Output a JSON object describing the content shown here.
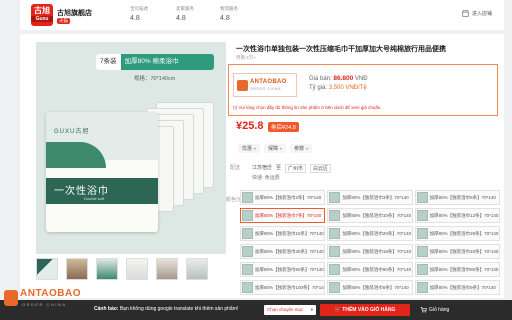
{
  "store": {
    "logo_text": "古旭",
    "logo_sub": "Guxu",
    "name": "古旭旗舰店",
    "tag": "天猫",
    "metrics": [
      {
        "label": "宝贝描述",
        "value": "4.8"
      },
      {
        "label": "卖家服务",
        "value": "4.8"
      },
      {
        "label": "物流服务",
        "value": "4.8"
      }
    ],
    "follow_label": "进入店铺"
  },
  "hero": {
    "badge_count": "7条装",
    "badge_text": "加厚80% 棉柔浴巾",
    "size_text": "规格：70*140cm",
    "pack_brand": "GUXU古旭",
    "pack_title": "一次性浴巾",
    "pack_subtitle": "Double soft"
  },
  "product": {
    "title": "一次性浴巾单独包装一次性压缩毛巾干加厚加大号纯棉旅行用品便携",
    "subtitle": "月销 2万+"
  },
  "extension": {
    "brand": "ANTAOBAO",
    "tagline": "ORDER CHINA",
    "price_label": "Giá bán:",
    "price_value": "86.800",
    "price_unit": "VNĐ",
    "rate_label": "Tỷ giá:",
    "rate_value": "3.500",
    "rate_unit": "VNĐ/Tệ",
    "note": "(!) Vui lòng chọn đầy đủ thông tin sản phẩm ở bên dưới để xem giá chuẩn."
  },
  "pricing": {
    "price": "¥25.8",
    "coupon": "券后¥24.8"
  },
  "services": [
    {
      "label": "优惠"
    },
    {
      "label": "保障"
    },
    {
      "label": "参数"
    }
  ],
  "shipping": {
    "label": "配送",
    "from": "江苏宿迁",
    "to_label": "至",
    "province": "广州市",
    "district": "白云区",
    "fee": "快递: 免运费"
  },
  "color_label": "颜色分类",
  "variants": [
    {
      "text": "加厚80%【独装浴巾2条】70*140",
      "selected": false
    },
    {
      "text": "加厚80%【独装浴巾3条】70*140",
      "selected": false
    },
    {
      "text": "加厚80%【独装浴巾5条】70*140",
      "selected": false
    },
    {
      "text": "加厚80%【独装浴巾7条】70*140",
      "selected": true
    },
    {
      "text": "加厚80%【独装浴巾10条】70*140",
      "selected": false
    },
    {
      "text": "加厚80%【独装浴巾12条】70*140",
      "selected": false
    },
    {
      "text": "加厚80%【独装浴巾15条】70*140",
      "selected": false
    },
    {
      "text": "加厚80%【独装浴巾20条】70*140",
      "selected": false
    },
    {
      "text": "加厚80%【独装浴巾25条】70*140",
      "selected": false
    },
    {
      "text": "加厚80%【独装浴巾30条】70*140",
      "selected": false
    },
    {
      "text": "加厚80%【独装浴巾18条】70*140",
      "selected": false
    },
    {
      "text": "加厚80%【独装浴巾40条】70*140",
      "selected": false
    },
    {
      "text": "加厚80%【独装浴巾50条】70*140",
      "selected": false
    },
    {
      "text": "加厚80%【独装浴巾60条】70*140",
      "selected": false
    },
    {
      "text": "加厚80%【独装浴巾80条】70*140",
      "selected": false
    },
    {
      "text": "加厚80%【独装浴巾100条】70*140",
      "selected": false
    },
    {
      "text": "加厚80%【独装浴巾8条】70*140",
      "selected": false
    },
    {
      "text": "加厚80%【独装浴巾9条】70*140",
      "selected": false
    }
  ],
  "bottom_bar": {
    "brand": "ANTAOBAO",
    "tagline": "ORDER CHINA",
    "warning_bold": "Cảnh báo:",
    "warning_text": "Bạn không dùng google translate khi thêm sản phẩm!",
    "select_placeholder": "Chọn chuyên mục",
    "add_to_cart": "THÊM VÀO GIỎ HÀNG",
    "cart_link": "Giỏ hàng"
  },
  "colors": {
    "accent": "#e1251b",
    "extension": "#e86a2a",
    "towel_green": "#2d6654"
  }
}
